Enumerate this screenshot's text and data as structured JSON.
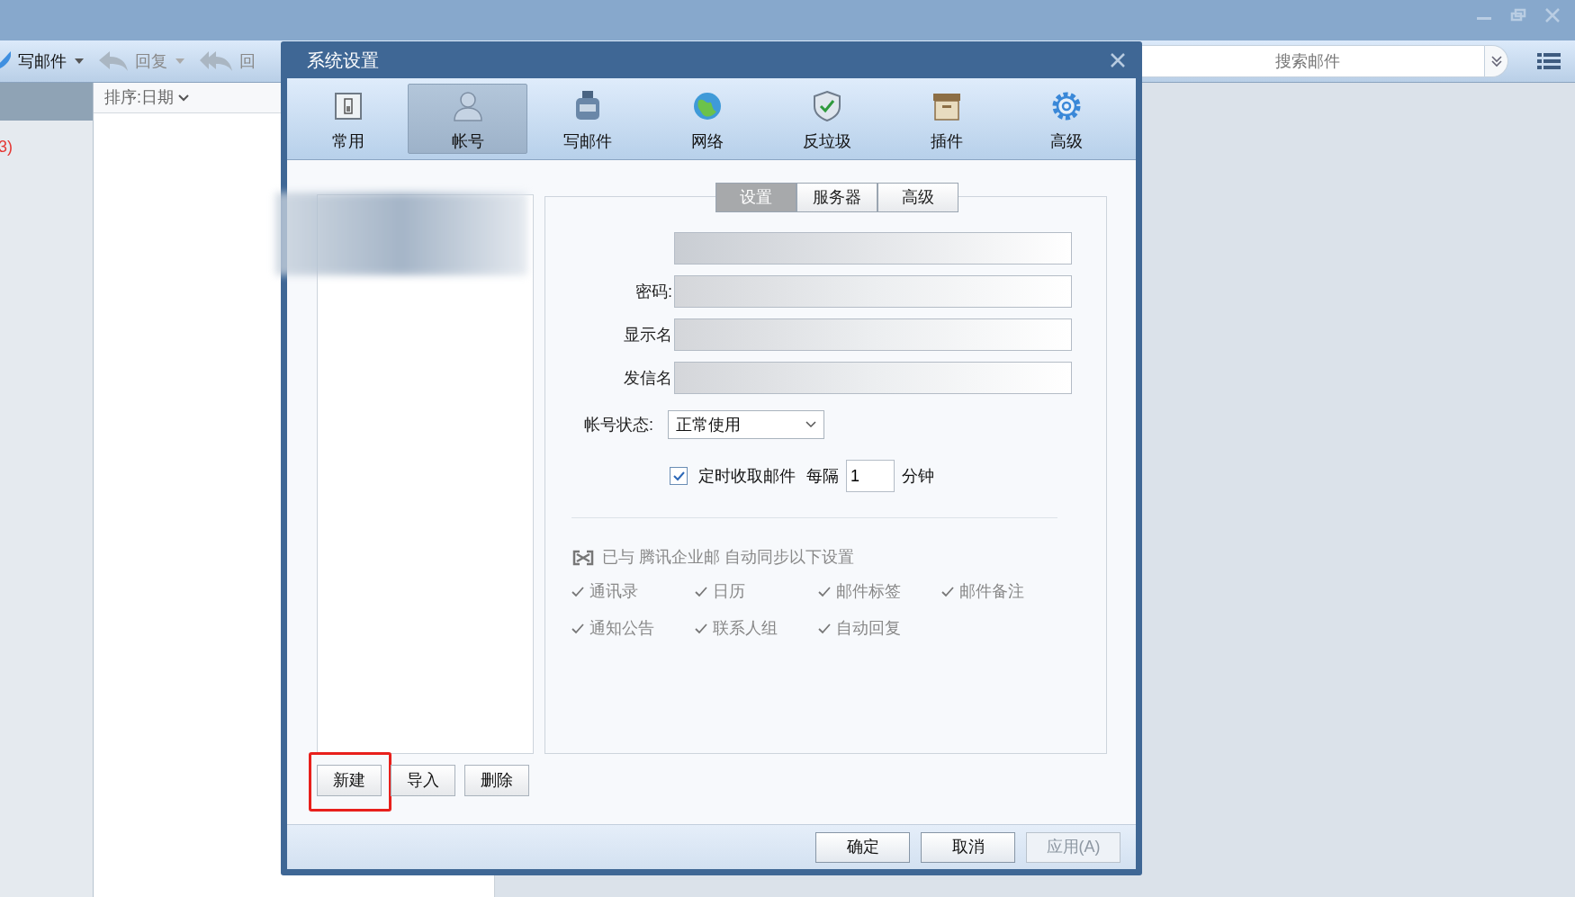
{
  "app": {
    "toolbar": [
      {
        "label": "写邮件",
        "kind": "compose"
      },
      {
        "label": "回复",
        "kind": "reply"
      },
      {
        "label": "回",
        "kind": "reply_all"
      }
    ],
    "sort": "排序:日期",
    "folder_count": "3)",
    "search": {
      "placeholder": "搜索邮件"
    }
  },
  "dialog": {
    "title": "系统设置",
    "categories": [
      {
        "label": "常用",
        "kind": "general",
        "selected": false
      },
      {
        "label": "帐号",
        "kind": "account",
        "selected": true
      },
      {
        "label": "写邮件",
        "kind": "compose",
        "selected": false
      },
      {
        "label": "网络",
        "kind": "network",
        "selected": false
      },
      {
        "label": "反垃圾",
        "kind": "antispam",
        "selected": false
      },
      {
        "label": "插件",
        "kind": "plugin",
        "selected": false
      },
      {
        "label": "高级",
        "kind": "advanced",
        "selected": false
      }
    ],
    "tabs": [
      {
        "label": "设置",
        "selected": true
      },
      {
        "label": "服务器",
        "selected": false
      },
      {
        "label": "高级",
        "selected": false
      }
    ],
    "fields": [
      {
        "kind": "redacted"
      },
      {
        "kind": "labeled",
        "label": "密码:"
      },
      {
        "kind": "labeled",
        "label": "显示名"
      },
      {
        "kind": "labeled",
        "label": "发信名"
      }
    ],
    "status": {
      "label": "帐号状态:",
      "value": "正常使用"
    },
    "auto_fetch": {
      "checked": true,
      "label": "定时收取邮件",
      "every": "每隔",
      "value": "1",
      "unit": "分钟"
    },
    "sync": {
      "heading": "已与 腾讯企业邮 自动同步以下设置",
      "items": [
        "通讯录",
        "日历",
        "邮件标签",
        "邮件备注",
        "通知公告",
        "联系人组",
        "自动回复"
      ]
    },
    "list_buttons": [
      {
        "label": "新建",
        "highlighted": true
      },
      {
        "label": "导入",
        "highlighted": false
      },
      {
        "label": "删除",
        "highlighted": false
      }
    ],
    "footer_buttons": [
      {
        "label": "确定",
        "disabled": false
      },
      {
        "label": "取消",
        "disabled": false
      },
      {
        "label": "应用(A)",
        "disabled": true
      }
    ]
  }
}
